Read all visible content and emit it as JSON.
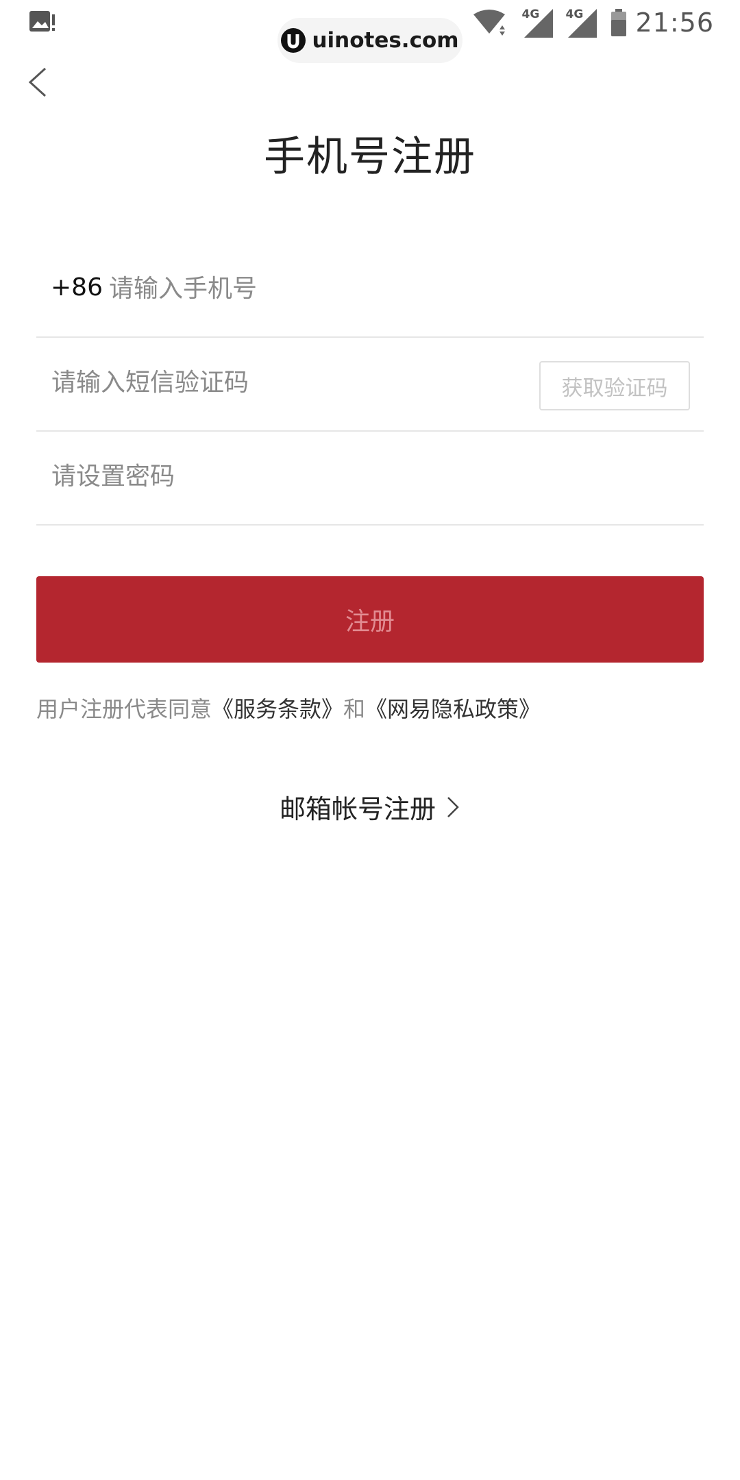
{
  "status_bar": {
    "time": "21:56",
    "network_label_1": "4G",
    "network_label_2": "4G",
    "icons": [
      "gallery-notification-icon",
      "wifi-icon",
      "signal-icon",
      "signal-icon",
      "battery-icon"
    ]
  },
  "watermark": {
    "text": "uinotes.com"
  },
  "header": {
    "back_icon": "chevron-left-icon",
    "title": "手机号注册"
  },
  "form": {
    "country_code": "+86",
    "phone_placeholder": "请输入手机号",
    "code_placeholder": "请输入短信验证码",
    "get_code_label": "获取验证码",
    "password_placeholder": "请设置密码",
    "submit_label": "注册"
  },
  "terms": {
    "prefix": "用户注册代表同意",
    "service_link": "《服务条款》",
    "conjunction": "和",
    "privacy_link": "《网易隐私政策》"
  },
  "email_register": {
    "label": "邮箱帐号注册",
    "icon": "chevron-right-icon"
  },
  "colors": {
    "primary": "#b4262f",
    "primary_text_disabled": "#e28c92",
    "placeholder": "#8a8a8a",
    "divider": "#e6e6e6"
  }
}
